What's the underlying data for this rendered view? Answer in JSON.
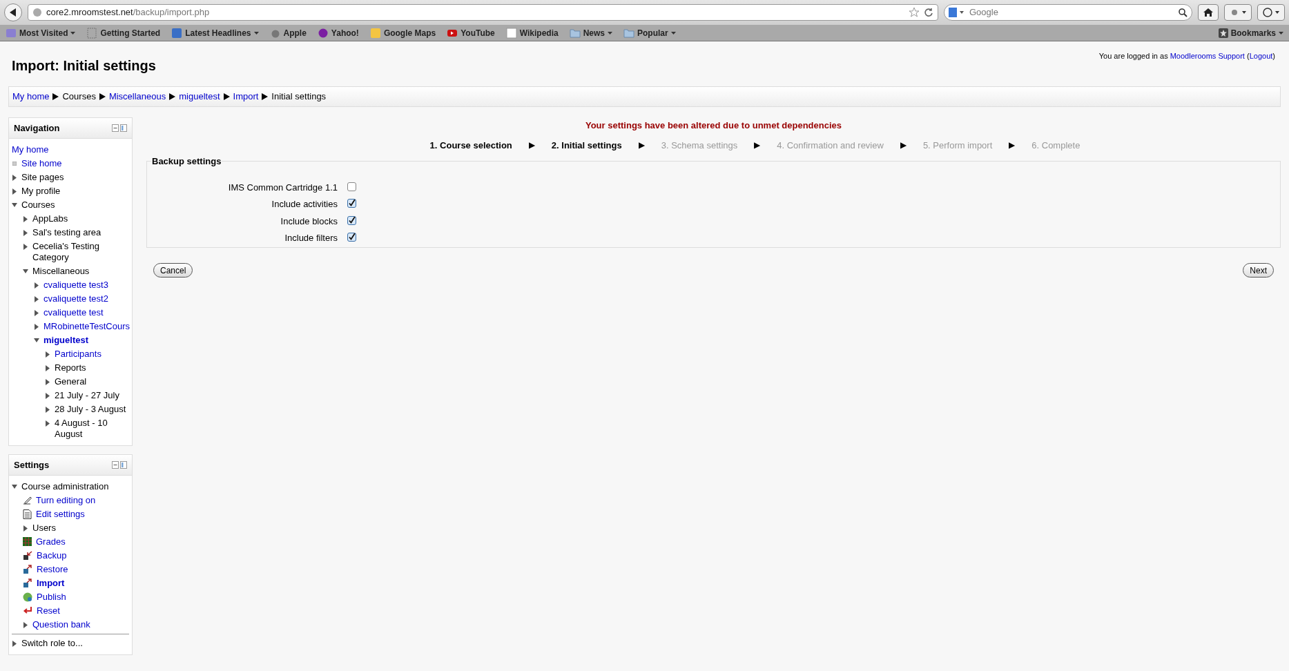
{
  "browser": {
    "url_host": "core2.mroomstest.net",
    "url_path": "/backup/import.php",
    "search_placeholder": "Google",
    "bookmarks": [
      {
        "label": "Most Visited",
        "kind": "star",
        "menu": true
      },
      {
        "label": "Getting Started",
        "kind": "page",
        "menu": false
      },
      {
        "label": "Latest Headlines",
        "kind": "feed",
        "menu": true
      },
      {
        "label": "Apple",
        "kind": "apple",
        "menu": false
      },
      {
        "label": "Yahoo!",
        "kind": "yahoo",
        "menu": false
      },
      {
        "label": "Google Maps",
        "kind": "maps",
        "menu": false
      },
      {
        "label": "YouTube",
        "kind": "video",
        "menu": false
      },
      {
        "label": "Wikipedia",
        "kind": "wiki",
        "menu": false
      },
      {
        "label": "News",
        "kind": "folder",
        "menu": true
      },
      {
        "label": "Popular",
        "kind": "folder",
        "menu": true
      }
    ],
    "bookmarks_menu": "Bookmarks"
  },
  "page": {
    "title": "Import: Initial settings",
    "login_prefix": "You are logged in as",
    "login_user": "Moodlerooms Support",
    "logout": "Logout",
    "open_paren": "(",
    "close_paren": ")",
    "breadcrumb": [
      {
        "label": "My home",
        "link": true
      },
      {
        "label": "Courses",
        "link": false
      },
      {
        "label": "Miscellaneous",
        "link": true
      },
      {
        "label": "migueltest",
        "link": true
      },
      {
        "label": "Import",
        "link": true
      },
      {
        "label": "Initial settings",
        "link": false
      }
    ]
  },
  "navigation": {
    "title": "Navigation",
    "items": [
      {
        "label": "My home",
        "kind": "plain",
        "link": true,
        "current": false
      },
      {
        "label": "Site home",
        "kind": "leaf",
        "link": true,
        "current": false
      },
      {
        "label": "Site pages",
        "kind": "branch",
        "expanded": false,
        "link": false,
        "current": false
      },
      {
        "label": "My profile",
        "kind": "branch",
        "expanded": false,
        "link": false,
        "current": false
      },
      {
        "label": "Courses",
        "kind": "branch",
        "expanded": true,
        "link": false,
        "current": false,
        "children": [
          {
            "label": "AppLabs",
            "kind": "branch",
            "expanded": false,
            "link": false,
            "current": false
          },
          {
            "label": "Sal's testing area",
            "kind": "branch",
            "expanded": false,
            "link": false,
            "current": false
          },
          {
            "label": "Cecelia's Testing Category",
            "kind": "branch",
            "expanded": false,
            "link": false,
            "current": false
          },
          {
            "label": "Miscellaneous",
            "kind": "branch",
            "expanded": true,
            "link": false,
            "current": false,
            "children": [
              {
                "label": "cvaliquette test3",
                "kind": "branch",
                "expanded": false,
                "link": true,
                "current": false
              },
              {
                "label": "cvaliquette test2",
                "kind": "branch",
                "expanded": false,
                "link": true,
                "current": false
              },
              {
                "label": "cvaliquette test",
                "kind": "branch",
                "expanded": false,
                "link": true,
                "current": false
              },
              {
                "label": "MRobinetteTestCours",
                "kind": "branch",
                "expanded": false,
                "link": true,
                "current": false
              },
              {
                "label": "migueltest",
                "kind": "branch",
                "expanded": true,
                "link": true,
                "current": true,
                "children": [
                  {
                    "label": "Participants",
                    "kind": "branch",
                    "expanded": false,
                    "link": true,
                    "current": false
                  },
                  {
                    "label": "Reports",
                    "kind": "branch",
                    "expanded": false,
                    "link": false,
                    "current": false
                  },
                  {
                    "label": "General",
                    "kind": "branch",
                    "expanded": false,
                    "link": false,
                    "current": false
                  },
                  {
                    "label": "21 July - 27 July",
                    "kind": "branch",
                    "expanded": false,
                    "link": false,
                    "current": false
                  },
                  {
                    "label": "28 July - 3 August",
                    "kind": "branch",
                    "expanded": false,
                    "link": false,
                    "current": false
                  },
                  {
                    "label": "4 August - 10 August",
                    "kind": "branch",
                    "expanded": false,
                    "link": false,
                    "current": false
                  }
                ]
              }
            ]
          }
        ]
      }
    ]
  },
  "settings": {
    "title": "Settings",
    "items": [
      {
        "label": "Course administration",
        "kind": "branch",
        "expanded": true,
        "link": false,
        "current": false,
        "children": [
          {
            "label": "Turn editing on",
            "kind": "pencil",
            "link": true,
            "current": false
          },
          {
            "label": "Edit settings",
            "kind": "document",
            "link": true,
            "current": false
          },
          {
            "label": "Users",
            "kind": "branch",
            "expanded": false,
            "link": false,
            "current": false
          },
          {
            "label": "Grades",
            "kind": "grades",
            "link": true,
            "current": false
          },
          {
            "label": "Backup",
            "kind": "backup",
            "link": true,
            "current": false
          },
          {
            "label": "Restore",
            "kind": "restore",
            "link": true,
            "current": false
          },
          {
            "label": "Import",
            "kind": "restore",
            "link": true,
            "current": true
          },
          {
            "label": "Publish",
            "kind": "globe",
            "link": true,
            "current": false
          },
          {
            "label": "Reset",
            "kind": "reset",
            "link": true,
            "current": false
          },
          {
            "label": "Question bank",
            "kind": "branch",
            "expanded": false,
            "link": true,
            "current": false
          }
        ]
      },
      {
        "label": "Switch role to...",
        "kind": "branch",
        "expanded": false,
        "link": false,
        "current": false,
        "divider": true
      }
    ]
  },
  "main": {
    "warning": "Your settings have been altered due to unmet dependencies",
    "steps": [
      {
        "label": "1. Course selection",
        "reached": true
      },
      {
        "label": "2. Initial settings",
        "reached": true
      },
      {
        "label": "3. Schema settings",
        "reached": false
      },
      {
        "label": "4. Confirmation and review",
        "reached": false
      },
      {
        "label": "5. Perform import",
        "reached": false
      },
      {
        "label": "6. Complete",
        "reached": false
      }
    ],
    "step_separator": "▶",
    "fieldset": {
      "legend": "Backup settings",
      "options": [
        {
          "label": "IMS Common Cartridge 1.1",
          "checked": false
        },
        {
          "label": "Include activities",
          "checked": true
        },
        {
          "label": "Include blocks",
          "checked": true
        },
        {
          "label": "Include filters",
          "checked": true
        }
      ]
    },
    "buttons": [
      {
        "label": "Cancel"
      },
      {
        "label": "Next"
      }
    ]
  }
}
